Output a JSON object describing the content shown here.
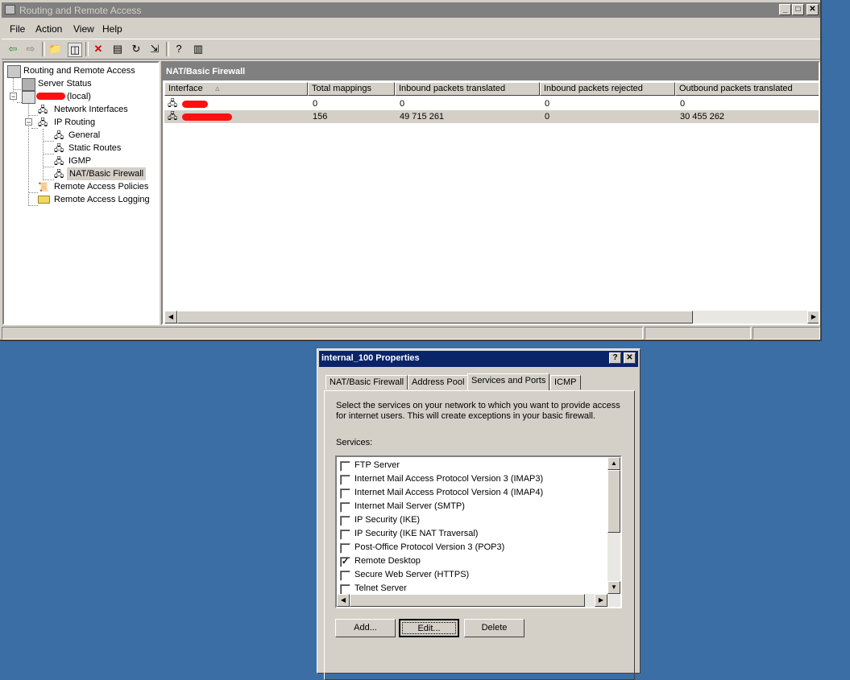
{
  "window": {
    "title": "Routing and Remote Access",
    "menu": [
      "File",
      "Action",
      "View",
      "Help"
    ]
  },
  "tree": {
    "root": "Routing and Remote Access",
    "server_status": "Server Status",
    "server_suffix": "(local)",
    "network_interfaces": "Network Interfaces",
    "ip_routing": "IP Routing",
    "general": "General",
    "static_routes": "Static Routes",
    "igmp": "IGMP",
    "nat": "NAT/Basic Firewall",
    "remote_access_policies": "Remote Access Policies",
    "remote_access_logging": "Remote Access Logging"
  },
  "main": {
    "heading": "NAT/Basic Firewall",
    "columns": [
      "Interface",
      "Total mappings",
      "Inbound packets translated",
      "Inbound packets rejected",
      "Outbound packets translated"
    ],
    "rows": [
      {
        "total": "0",
        "inbound": "0",
        "rejected": "0",
        "outbound": "0"
      },
      {
        "total": "156",
        "inbound": "49 715 261",
        "rejected": "0",
        "outbound": "30 455 262"
      }
    ]
  },
  "dialog": {
    "title": "internal_100 Properties",
    "tabs": [
      "NAT/Basic Firewall",
      "Address Pool",
      "Services and Ports",
      "ICMP"
    ],
    "description_line1": "Select the services on your network to which you want to provide access",
    "description_line2": "for internet users.  This will create exceptions in your basic firewall.",
    "services_label": "Services:",
    "services": [
      {
        "label": "FTP Server",
        "checked": false
      },
      {
        "label": "Internet Mail Access Protocol Version 3 (IMAP3)",
        "checked": false
      },
      {
        "label": "Internet Mail Access Protocol Version 4 (IMAP4)",
        "checked": false
      },
      {
        "label": "Internet Mail Server (SMTP)",
        "checked": false
      },
      {
        "label": "IP Security (IKE)",
        "checked": false
      },
      {
        "label": "IP Security (IKE NAT Traversal)",
        "checked": false
      },
      {
        "label": "Post-Office Protocol Version 3 (POP3)",
        "checked": false
      },
      {
        "label": "Remote Desktop",
        "checked": true
      },
      {
        "label": "Secure Web Server (HTTPS)",
        "checked": false
      },
      {
        "label": "Telnet Server",
        "checked": false
      }
    ],
    "buttons": {
      "add": "Add...",
      "edit": "Edit...",
      "delete": "Delete"
    }
  }
}
